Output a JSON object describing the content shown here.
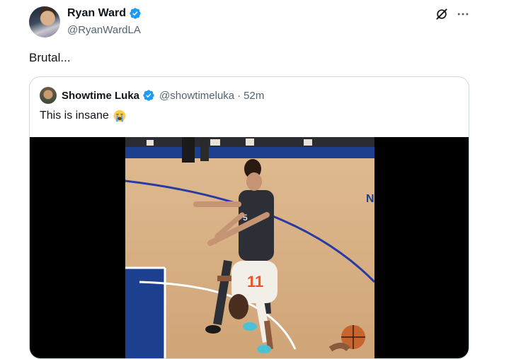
{
  "post": {
    "author_name": "Ryan Ward",
    "author_handle": "@RyanWardLA",
    "text": "Brutal..."
  },
  "quote": {
    "author_name": "Showtime Luka",
    "author_handle": "@showtimeluka",
    "separator": "·",
    "time": "52m",
    "text": "This is insane"
  },
  "icons": {
    "verified": "verified-badge-icon",
    "grok": "grok-icon",
    "more": "more-options-icon",
    "emoji": "loudly-crying-face-emoji"
  },
  "colors": {
    "verified": "#1d9bf0",
    "text_primary": "#0f1419",
    "text_secondary": "#536471",
    "border": "#cfd9de"
  },
  "media": {
    "type": "video",
    "jersey_number": "11"
  }
}
